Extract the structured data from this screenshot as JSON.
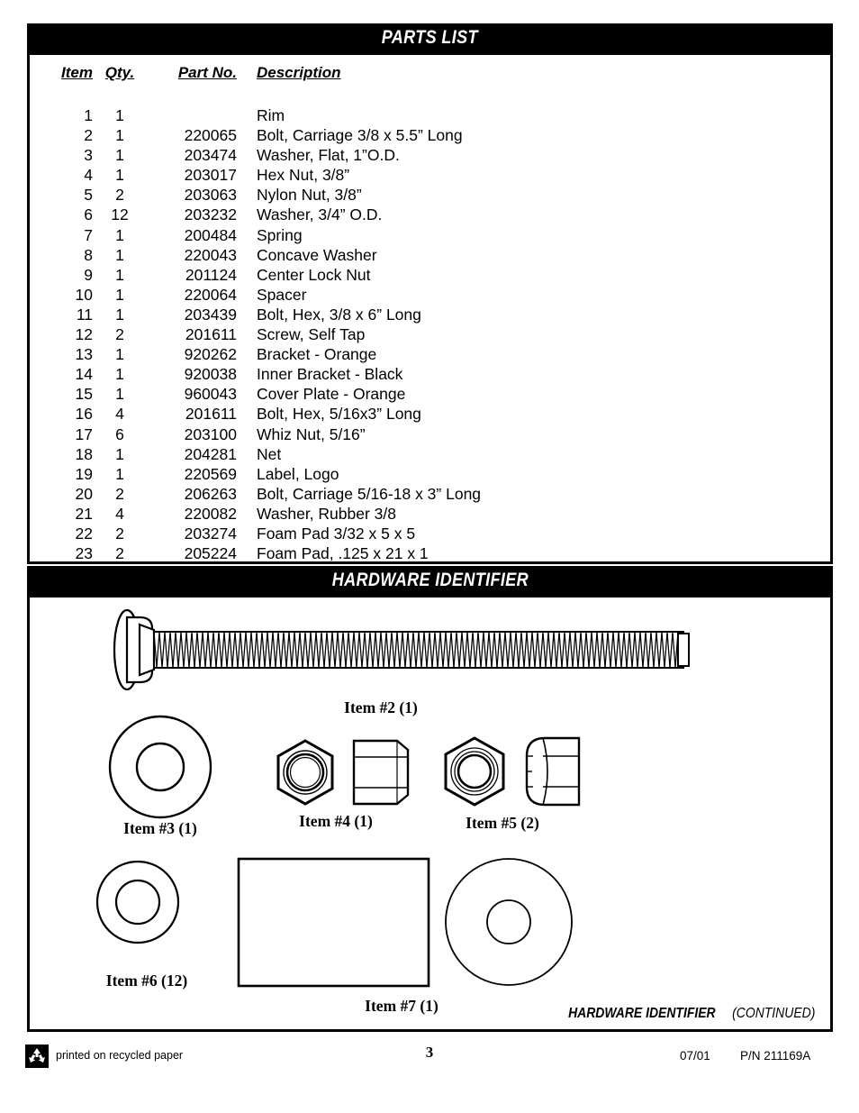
{
  "banners": {
    "parts_list": "PARTS LIST",
    "hardware_identifier": "HARDWARE IDENTIFIER"
  },
  "parts_table": {
    "headers": [
      "Item",
      "Qty.",
      "Part No.",
      "Description"
    ],
    "rows": [
      {
        "item": "1",
        "qty": "1",
        "part_no": "",
        "description": "Rim"
      },
      {
        "item": "2",
        "qty": "1",
        "part_no": "220065",
        "description": "Bolt, Carriage 3/8 x 5.5” Long"
      },
      {
        "item": "3",
        "qty": "1",
        "part_no": "203474",
        "description": "Washer, Flat, 1”O.D."
      },
      {
        "item": "4",
        "qty": "1",
        "part_no": "203017",
        "description": "Hex Nut, 3/8”"
      },
      {
        "item": "5",
        "qty": "2",
        "part_no": "203063",
        "description": "Nylon Nut, 3/8”"
      },
      {
        "item": "6",
        "qty": "12",
        "part_no": "203232",
        "description": "Washer, 3/4” O.D."
      },
      {
        "item": "7",
        "qty": "1",
        "part_no": "200484",
        "description": "Spring"
      },
      {
        "item": "8",
        "qty": "1",
        "part_no": "220043",
        "description": "Concave Washer"
      },
      {
        "item": "9",
        "qty": "1",
        "part_no": "201124",
        "description": "Center Lock Nut"
      },
      {
        "item": "10",
        "qty": "1",
        "part_no": "220064",
        "description": "Spacer"
      },
      {
        "item": "11",
        "qty": "1",
        "part_no": "203439",
        "description": "Bolt, Hex, 3/8 x 6” Long"
      },
      {
        "item": "12",
        "qty": "2",
        "part_no": "201611",
        "description": "Screw, Self Tap"
      },
      {
        "item": "13",
        "qty": "1",
        "part_no": "920262",
        "description": "Bracket - Orange"
      },
      {
        "item": "14",
        "qty": "1",
        "part_no": "920038",
        "description": "Inner Bracket - Black"
      },
      {
        "item": "15",
        "qty": "1",
        "part_no": "960043",
        "description": "Cover Plate - Orange"
      },
      {
        "item": "16",
        "qty": "4",
        "part_no": "201611",
        "description": "Bolt, Hex, 5/16x3” Long"
      },
      {
        "item": "17",
        "qty": "6",
        "part_no": "203100",
        "description": "Whiz Nut, 5/16”"
      },
      {
        "item": "18",
        "qty": "1",
        "part_no": "204281",
        "description": "Net"
      },
      {
        "item": "19",
        "qty": "1",
        "part_no": "220569",
        "description": "Label, Logo"
      },
      {
        "item": "20",
        "qty": "2",
        "part_no": "206263",
        "description": "Bolt, Carriage 5/16-18 x 3” Long"
      },
      {
        "item": "21",
        "qty": "4",
        "part_no": "220082",
        "description": "Washer, Rubber 3/8"
      },
      {
        "item": "22",
        "qty": "2",
        "part_no": "203274",
        "description": "Foam Pad 3/32 x 5 x 5"
      },
      {
        "item": "23",
        "qty": "2",
        "part_no": "205224",
        "description": "Foam Pad, .125 x 21 x 1"
      }
    ]
  },
  "hardware_identifier": {
    "figures": [
      {
        "id": "carriage-bolt",
        "label": "Item #2 (1)"
      },
      {
        "id": "flat-washer",
        "label": "Item #3 (1)"
      },
      {
        "id": "hex-nut",
        "label": "Item #4 (1)"
      },
      {
        "id": "nylon-nut",
        "label": "Item #5 (2)"
      },
      {
        "id": "small-washer",
        "label": "Item #6 (12)"
      },
      {
        "id": "spring",
        "label": "Item #7 (1)"
      }
    ],
    "continued_bold": "HARDWARE IDENTIFIER",
    "continued_italic": "(CONTINUED)"
  },
  "footer": {
    "recycled_text": "printed on recycled paper",
    "recycle_icon": "recycle-icon",
    "page_number": "3",
    "date": "07/01",
    "part_number": "P/N 211169A"
  }
}
